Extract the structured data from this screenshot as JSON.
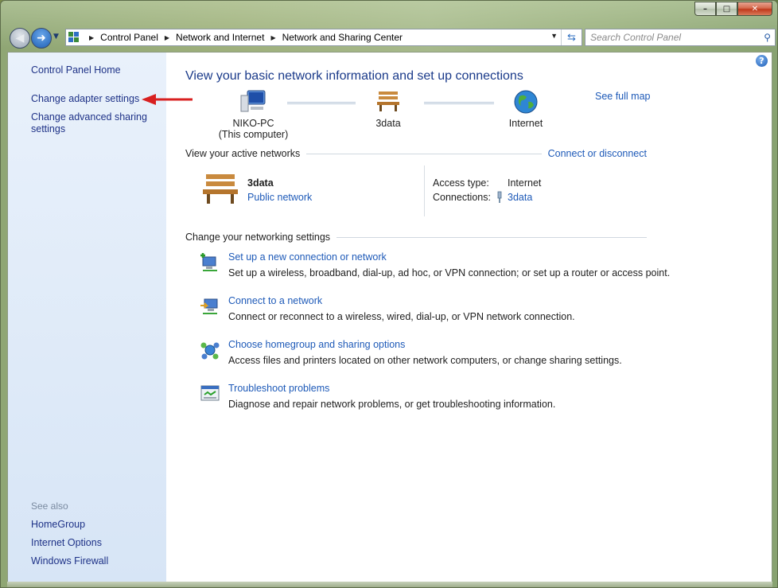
{
  "window": {
    "caption": {
      "minimize": "–",
      "maximize": "□",
      "close": "✕"
    }
  },
  "address_bar": {
    "crumbs": [
      "Control Panel",
      "Network and Internet",
      "Network and Sharing Center"
    ],
    "search_placeholder": "Search Control Panel"
  },
  "sidebar": {
    "items": [
      {
        "label": "Control Panel Home"
      },
      {
        "label": "Change adapter settings"
      },
      {
        "label": "Change advanced sharing settings"
      }
    ],
    "see_also_label": "See also",
    "see_also": [
      {
        "label": "HomeGroup"
      },
      {
        "label": "Internet Options"
      },
      {
        "label": "Windows Firewall"
      }
    ]
  },
  "main": {
    "title": "View your basic network information and set up connections",
    "see_full_map": "See full map",
    "map": {
      "computer_name": "NIKO-PC",
      "computer_sub": "(This computer)",
      "network": "3data",
      "internet": "Internet"
    },
    "active_networks": {
      "heading": "View your active networks",
      "connect_link": "Connect or disconnect",
      "network_name": "3data",
      "network_type": "Public network",
      "access_type_label": "Access type:",
      "access_type_value": "Internet",
      "connections_label": "Connections:",
      "connections_value": "3data"
    },
    "settings": {
      "heading": "Change your networking settings",
      "tasks": [
        {
          "title": "Set up a new connection or network",
          "desc": "Set up a wireless, broadband, dial-up, ad hoc, or VPN connection; or set up a router or access point."
        },
        {
          "title": "Connect to a network",
          "desc": "Connect or reconnect to a wireless, wired, dial-up, or VPN network connection."
        },
        {
          "title": "Choose homegroup and sharing options",
          "desc": "Access files and printers located on other network computers, or change sharing settings."
        },
        {
          "title": "Troubleshoot problems",
          "desc": "Diagnose and repair network problems, or get troubleshooting information."
        }
      ]
    }
  }
}
